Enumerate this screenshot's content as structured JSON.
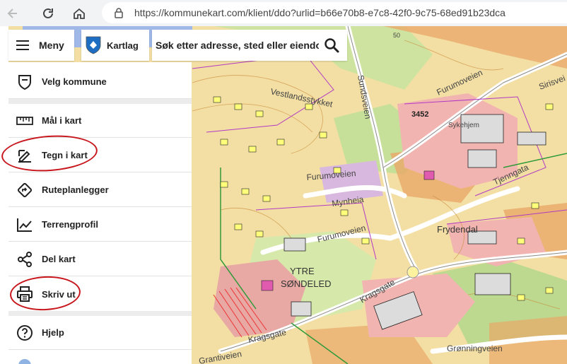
{
  "browser": {
    "url": "https://kommunekart.com/klient/ddo?urlid=b66e70b8-e7c8-42f0-9c75-68ed91b23dca"
  },
  "topbar": {
    "menu_label": "Meny",
    "kartlag_label": "Kartlag",
    "search_placeholder": "Søk etter adresse, sted eller eiendom"
  },
  "sidebar": {
    "items": [
      {
        "label": "Velg kommune",
        "icon": "shield-icon"
      },
      {
        "label": "Mål i kart",
        "icon": "ruler-icon"
      },
      {
        "label": "Tegn i kart",
        "icon": "draw-icon"
      },
      {
        "label": "Ruteplanlegger",
        "icon": "route-icon"
      },
      {
        "label": "Terrengprofil",
        "icon": "chart-line-icon"
      },
      {
        "label": "Del kart",
        "icon": "share-icon"
      },
      {
        "label": "Skriv ut",
        "icon": "printer-icon"
      },
      {
        "label": "Hjelp",
        "icon": "help-icon"
      }
    ]
  },
  "map": {
    "labels": [
      {
        "text": "Vestlandsstykket"
      },
      {
        "text": "Sundsveien"
      },
      {
        "text": "Furumoveien"
      },
      {
        "text": "3452"
      },
      {
        "text": "Sykehjem"
      },
      {
        "text": "Sirisvei"
      },
      {
        "text": "Furumoveien"
      },
      {
        "text": "Mynheia"
      },
      {
        "text": "Furumoveien"
      },
      {
        "text": "Frydendal"
      },
      {
        "text": "Tjenngata"
      },
      {
        "text": "YTRE"
      },
      {
        "text": "SØNDELED"
      },
      {
        "text": "Kragsgate"
      },
      {
        "text": "Kragsgate"
      },
      {
        "text": "Grønningveien"
      },
      {
        "text": "Grantiveien"
      },
      {
        "text": "50"
      }
    ]
  },
  "colors": {
    "annotation": "#c8161d",
    "map_base": "#f3dfa4",
    "map_green": "#b9d98c",
    "map_orange": "#e9a868"
  }
}
